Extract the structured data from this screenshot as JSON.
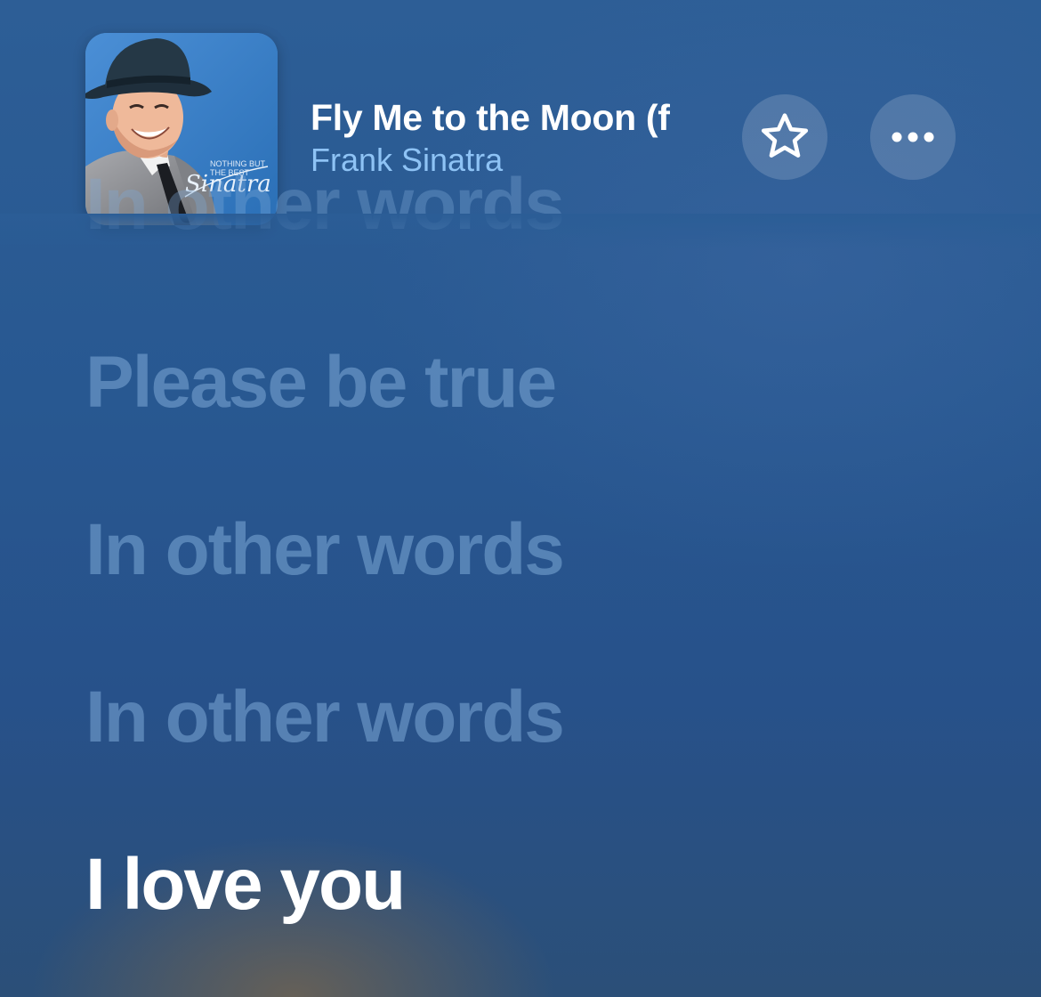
{
  "now_playing": {
    "artwork": {
      "artist_signature": "Sinatra",
      "album_subtitle_line1": "NOTHING BUT",
      "album_subtitle_line2": "THE BEST"
    },
    "title": "Fly Me to the Moon (f",
    "artist": "Frank Sinatra",
    "favorite_icon": "star-outline-icon",
    "more_icon": "ellipsis-icon"
  },
  "lyrics": {
    "partial_line": "In other words",
    "lines": [
      {
        "text": "Please be true",
        "state": "past"
      },
      {
        "text": "In other words",
        "state": "past"
      },
      {
        "text": "In other words",
        "state": "past"
      },
      {
        "text": "I love you",
        "state": "current"
      }
    ]
  },
  "colors": {
    "background": "#285891",
    "artist_text": "#8ec3f5",
    "active_lyric": "#ffffff",
    "dim_lyric": "#7daad7"
  }
}
